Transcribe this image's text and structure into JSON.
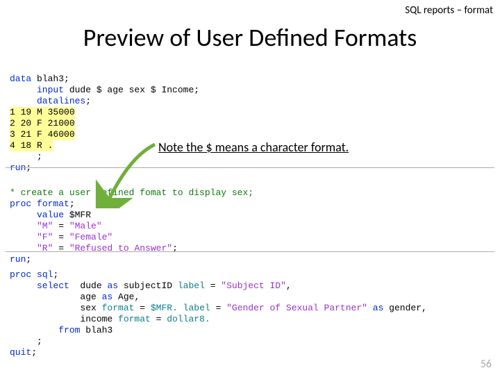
{
  "header": "SQL reports – format",
  "title": "Preview of User Defined Formats",
  "annotation": "Note the $ means a character format.",
  "page_number": "56",
  "code_block_1": {
    "l1a": "data",
    "l1b": " blah3;",
    "l2a": "     input",
    "l2b": " dude $ age sex $ Income;",
    "l3": "     datalines",
    "d1": "1 19 M 35000",
    "d2": "2 20 F 21000",
    "d3": "3 21 F 46000",
    "d4": "4 18 R .",
    "l4a": "     ;",
    "l5a": "run",
    "l5b": ";"
  },
  "code_block_2": {
    "c1": "* create a user defined fomat to display sex;",
    "l1a": "proc",
    "l1b": " ",
    "l1c": "format",
    "l1d": ";",
    "l2a": "     value",
    "l2b": " $MFR",
    "v1a": "     \"M\"",
    "v1b": " = ",
    "v1c": "\"Male\"",
    "v2a": "     \"F\"",
    "v2b": " = ",
    "v2c": "\"Female\"",
    "v3a": "     \"R\"",
    "v3b": " = ",
    "v3c": "\"Refused to Answer\"",
    "v3d": ";",
    "l3a": "run",
    "l3b": ";"
  },
  "code_block_3": {
    "l1a": "proc",
    "l1b": " ",
    "l1c": "sql",
    "l1d": ";",
    "l2a": "     select",
    "l2b": "  dude ",
    "l2c": "as",
    "l2d": " subjectID ",
    "l2e": "label",
    "l2f": " = ",
    "l2g": "\"Subject ID\"",
    "l2h": ",",
    "l3a": "             age ",
    "l3b": "as",
    "l3c": " Age,",
    "l4a": "             sex ",
    "l4b": "format",
    "l4c": " = ",
    "l4d": "$MFR.",
    "l4e": " ",
    "l4f": "label",
    "l4g": " = ",
    "l4h": "\"Gender of Sexual Partner\"",
    "l4i": " ",
    "l4j": "as",
    "l4k": " gender,",
    "l5a": "             income ",
    "l5b": "format",
    "l5c": " = ",
    "l5d": "dollar8.",
    "l6a": "         from",
    "l6b": " blah3",
    "l7": "     ;",
    "l8a": "quit",
    "l8b": ";"
  }
}
